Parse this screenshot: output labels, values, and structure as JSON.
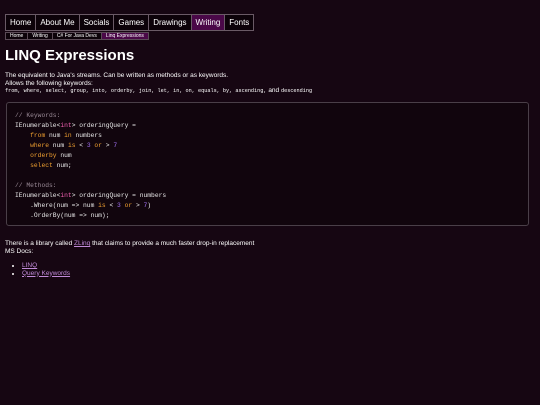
{
  "nav": [
    "Home",
    "About Me",
    "Socials",
    "Games",
    "Drawings",
    "Writing",
    "Fonts"
  ],
  "nav_active": "Writing",
  "breadcrumb": [
    "Home",
    "Writing",
    "C# For Java Devs",
    "Linq Expressions"
  ],
  "page_title": "LINQ Expressions",
  "intro": {
    "line1": "The equivalent to Java's streams. Can be written as methods or as keywords.",
    "line2": "Allows the following keywords:",
    "keywords": "from, where, select, group, into, orderby, join, let, in, on, equals, by, ascending,",
    "and": "and",
    "last_keyword": "descending"
  },
  "code": {
    "keywords_comment": "// Keywords:",
    "methods_comment": "// Methods:"
  },
  "after": {
    "prefix": "There is a library called",
    "link": "ZLinq",
    "suffix": "that claims to provide a much faster drop-in replacement",
    "ms_docs": "MS Docs:"
  },
  "refs": [
    "LINQ",
    "Query Keywords"
  ],
  "colors": {
    "background": "#160612",
    "active_tab": "#4a0848",
    "link": "#c08ad8",
    "keyword": "#f0a030",
    "type": "#f060b0",
    "number": "#a070f0",
    "comment": "#9a8a96"
  }
}
